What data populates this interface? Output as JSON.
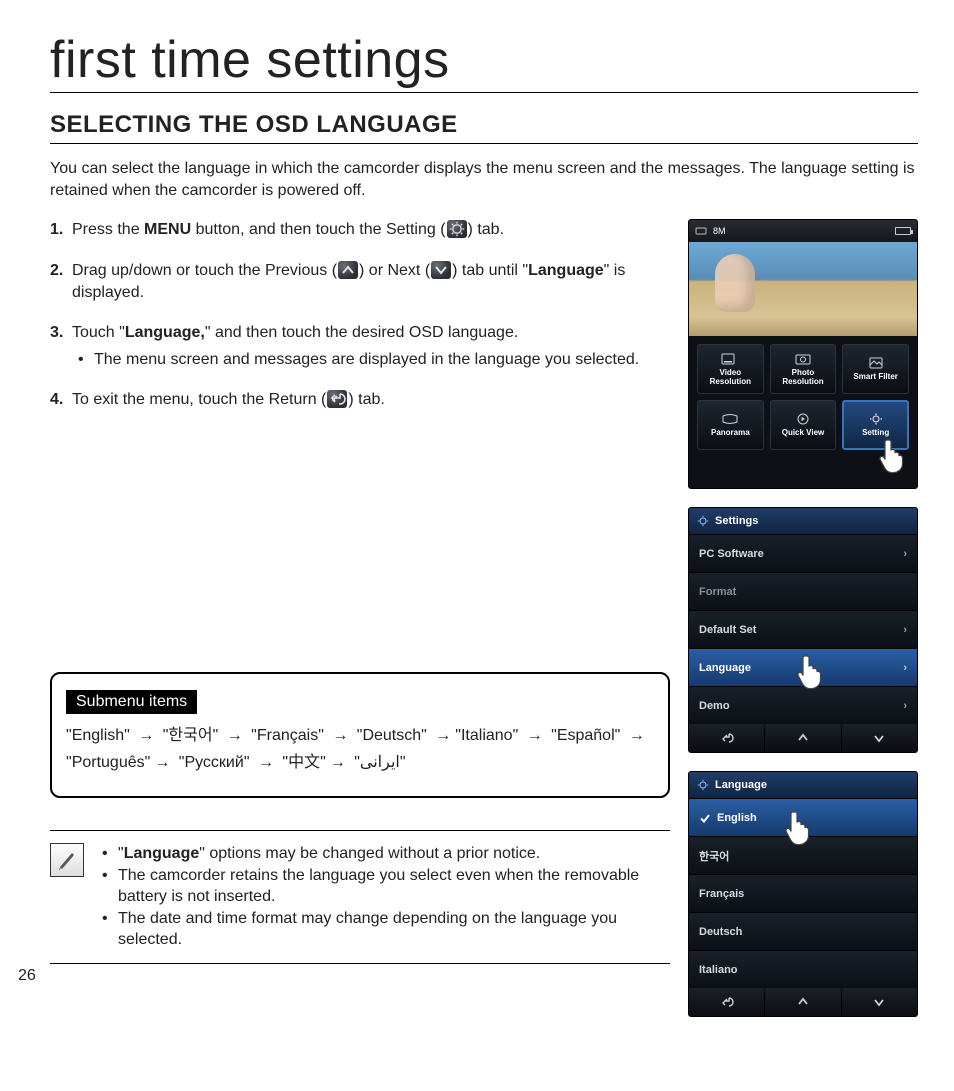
{
  "page_number": "26",
  "title": "first time settings",
  "section": "SELECTING THE OSD LANGUAGE",
  "intro": "You can select the language in which the camcorder displays the menu screen and the messages. The language setting is retained when the camcorder is powered off.",
  "steps": {
    "s1a": "Press the ",
    "s1b": "MENU",
    "s1c": " button, and then touch the Setting (",
    "s1d": ") tab.",
    "s2a": "Drag up/down or touch the Previous (",
    "s2b": ") or Next (",
    "s2c": ") tab until \"",
    "s2d": "Language",
    "s2e": "\" is displayed.",
    "s3a": "Touch \"",
    "s3b": "Language,",
    "s3c": "\" and then touch the desired OSD language.",
    "s3sub": "The menu screen and messages are displayed in the language you selected.",
    "s4a": "To exit the menu, touch the Return (",
    "s4b": ") tab."
  },
  "submenu": {
    "badge": "Submenu items",
    "items": [
      "English",
      "한국어",
      "Français",
      "Deutsch",
      "Italiano",
      "Español",
      "Português",
      "Русский",
      "中文",
      "ایرانی"
    ]
  },
  "notes": {
    "n1a": "\"",
    "n1b": "Language",
    "n1c": "\" options may be changed without a prior notice.",
    "n2": "The camcorder retains the language you select even when the removable battery is not inserted.",
    "n3": "The date and time format may change depending on the language you selected."
  },
  "screen1": {
    "topbar_mode": "8M",
    "tiles": [
      "Video Resolution",
      "Photo Resolution",
      "Smart Filter",
      "Panorama",
      "Quick View",
      "Setting"
    ]
  },
  "screen2": {
    "header": "Settings",
    "rows": [
      "PC Software",
      "Format",
      "Default Set",
      "Language",
      "Demo"
    ]
  },
  "screen3": {
    "header": "Language",
    "rows": [
      "English",
      "한국어",
      "Français",
      "Deutsch",
      "Italiano"
    ]
  }
}
